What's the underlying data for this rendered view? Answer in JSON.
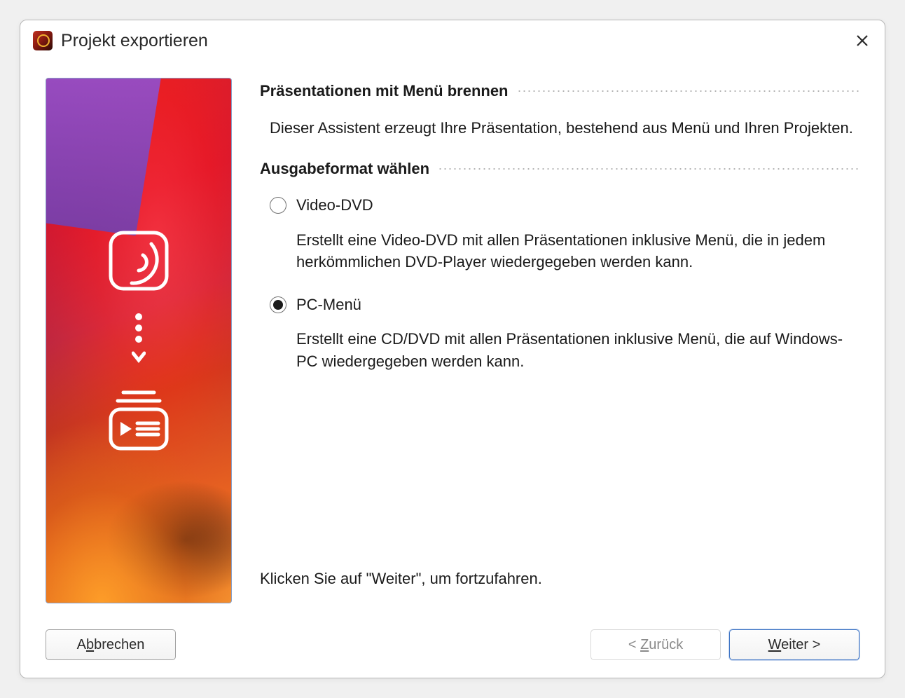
{
  "window": {
    "title": "Projekt exportieren"
  },
  "sections": {
    "burn": {
      "heading": "Präsentationen mit Menü brennen",
      "description": "Dieser Assistent erzeugt Ihre Präsentation, bestehend aus Menü und Ihren Projekten."
    },
    "format": {
      "heading": "Ausgabeformat wählen",
      "options": {
        "video_dvd": {
          "label": "Video-DVD",
          "selected": false,
          "description": "Erstellt eine Video-DVD mit allen Präsentationen inklusive Menü, die in jedem herkömmlichen DVD-Player wiedergegeben werden kann."
        },
        "pc_menu": {
          "label": "PC-Menü",
          "selected": true,
          "description": "Erstellt eine CD/DVD mit allen Präsentationen inklusive Menü, die auf Windows-PC wiedergegeben werden kann."
        }
      }
    }
  },
  "hint": "Klicken Sie auf \"Weiter\", um fortzufahren.",
  "buttons": {
    "cancel_pre": "A",
    "cancel_mn": "b",
    "cancel_post": "brechen",
    "back_pre": "< ",
    "back_mn": "Z",
    "back_post": "urück",
    "back_enabled": false,
    "next_pre": "",
    "next_mn": "W",
    "next_post": "eiter >"
  }
}
